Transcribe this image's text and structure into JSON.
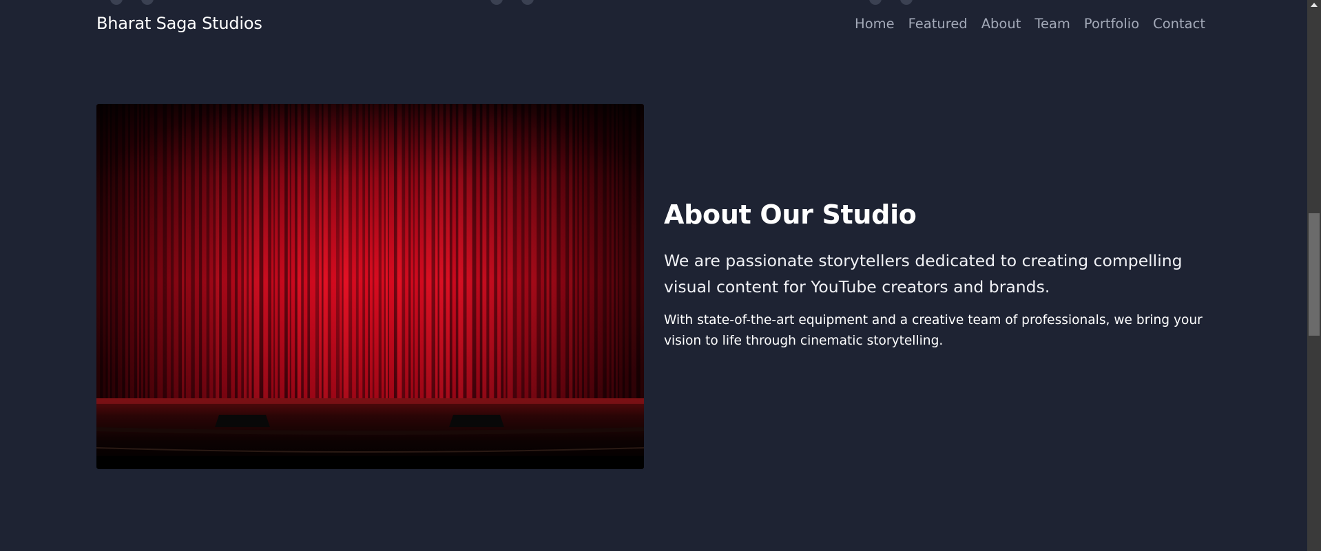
{
  "navbar": {
    "brand": "Bharat Saga Studios",
    "links": [
      {
        "label": "Home"
      },
      {
        "label": "Featured"
      },
      {
        "label": "About"
      },
      {
        "label": "Team"
      },
      {
        "label": "Portfolio"
      },
      {
        "label": "Contact"
      }
    ]
  },
  "about": {
    "title": "About Our Studio",
    "lead": "We are passionate storytellers dedicated to creating compelling visual content for YouTube creators and brands.",
    "body": "With state-of-the-art equipment and a creative team of professionals, we bring your vision to life through cinematic storytelling.",
    "image_subject": "red theater stage curtain"
  },
  "colors": {
    "background": "#1e2333",
    "text": "#ffffff",
    "nav_link": "#a3a9b8",
    "curtain_red": "#d0061a"
  },
  "icons": [
    "scroll-up-arrow-icon"
  ]
}
